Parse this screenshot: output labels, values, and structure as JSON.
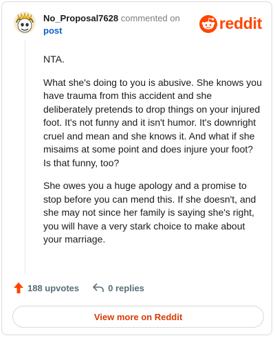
{
  "header": {
    "username": "No_Proposal7628",
    "action": "commented on",
    "post_link": "post",
    "brand": "reddit"
  },
  "comment": {
    "paragraphs": [
      "NTA.",
      "What she's doing to you is abusive. She knows you have trauma from this accident and she deliberately pretends to drop things on your injured foot. It's not funny and it isn't humor. It's downright cruel and mean and she knows it. And what if she misaims at some point and does injure your foot? Is that funny, too?",
      "She owes you a huge apology and a promise to stop before you can mend this. If she doesn't, and she may not since her family is saying she's right, you will have a very stark choice to make about your marriage."
    ]
  },
  "actions": {
    "upvotes": "188 upvotes",
    "replies": "0 replies"
  },
  "footer": {
    "view_more": "View more on Reddit"
  },
  "colors": {
    "brand": "#ff4500",
    "upvote": "#ff4500",
    "link": "#0b61c7",
    "button_text": "#d93a00"
  },
  "icons": {
    "avatar": "user-avatar",
    "logo": "reddit-snoo-icon",
    "upvote": "upvote-arrow-icon",
    "reply": "reply-arrow-icon"
  }
}
